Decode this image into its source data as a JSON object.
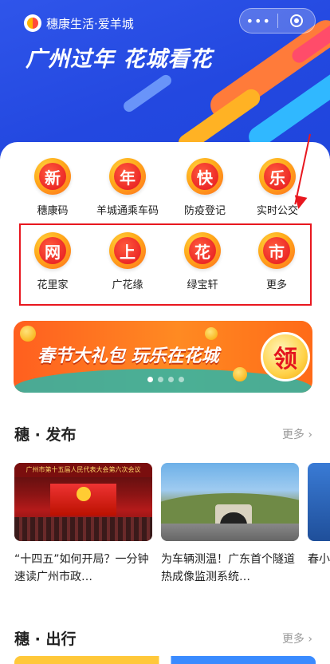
{
  "header": {
    "app_name": "穗康生活·爱羊城",
    "capsule_more": "•••",
    "banner_title": "广州过年 花城看花"
  },
  "services": {
    "row1": [
      {
        "glyph": "新",
        "label": "穗康码"
      },
      {
        "glyph": "年",
        "label": "羊城通乘车码"
      },
      {
        "glyph": "快",
        "label": "防疫登记"
      },
      {
        "glyph": "乐",
        "label": "实时公交"
      }
    ],
    "row2": [
      {
        "glyph": "网",
        "label": "花里家"
      },
      {
        "glyph": "上",
        "label": "广花缘"
      },
      {
        "glyph": "花",
        "label": "绿宝轩"
      },
      {
        "glyph": "市",
        "label": "更多"
      }
    ]
  },
  "promo": {
    "text": "春节大礼包 玩乐在花城",
    "button": "领"
  },
  "news": {
    "title": "穗 · 发布",
    "more": "更多 ›",
    "items": [
      {
        "image_caption": "广州市第十五届人民代表大会第六次会议",
        "title": "“十四五”如何开局？一分钟速读广州市政…"
      },
      {
        "title": "为车辆测温！广东首个隧道热成像监测系统…"
      },
      {
        "title": "春小"
      }
    ]
  },
  "travel": {
    "title": "穗 · 出行",
    "more": "更多 ›"
  },
  "colors": {
    "hero_blue": "#2348e0",
    "highlight_red": "#e8171f",
    "promo_orange": "#ff7a22"
  }
}
